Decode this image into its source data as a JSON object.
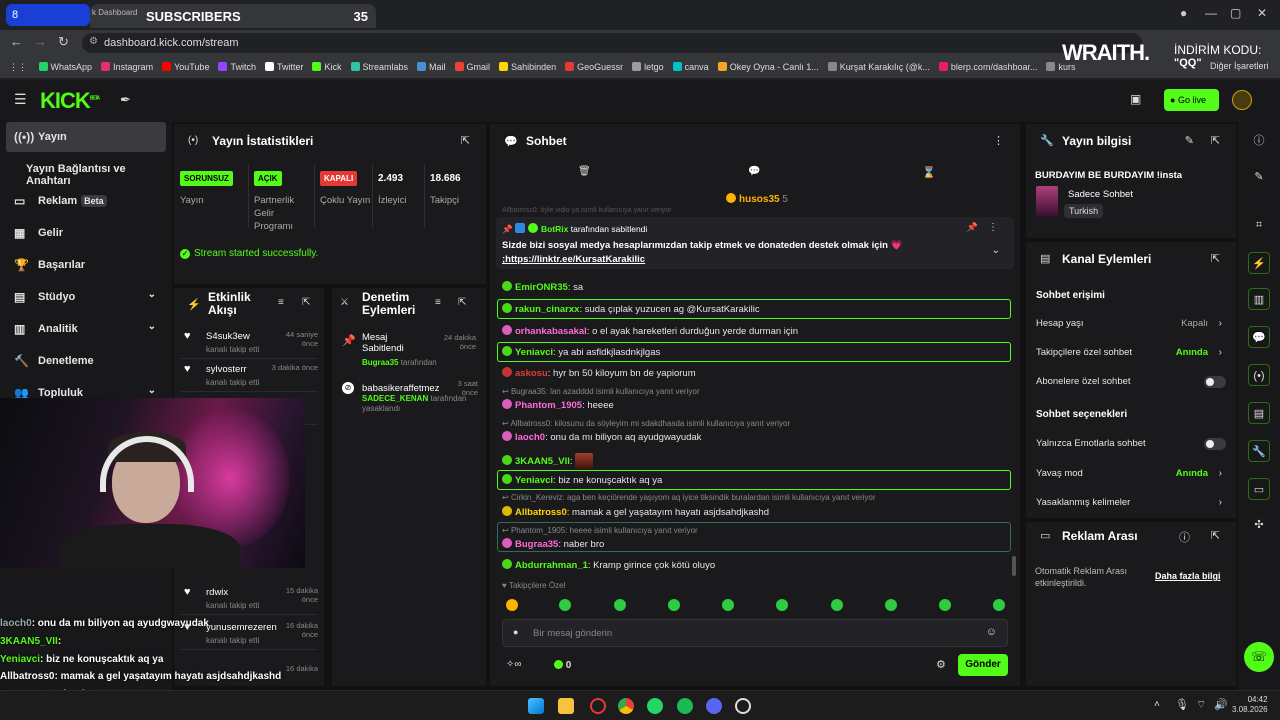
{
  "browser": {
    "tab_left_number": "8",
    "tab_label_small": "k Dashboard",
    "tab_title": "SUBSCRIBERS",
    "tab_count": "35",
    "url": "dashboard.kick.com/stream",
    "bookmarks": [
      "WhatsApp",
      "Instagram",
      "YouTube",
      "Twitch",
      "Twitter",
      "Kick",
      "Streamlabs",
      "Mail",
      "Gmail",
      "Sahibinden",
      "GeoGuessr",
      "letgo",
      "canva",
      "Okey Oyna - Canlı 1...",
      "Kurşat Karakılıç (@k...",
      "blerp.com/dashboar...",
      "kurs"
    ],
    "bookmark_colors": [
      "#25d366",
      "#e1306c",
      "#ff0000",
      "#9146ff",
      "#ffffff",
      "#53fc18",
      "#31c3a2",
      "#4a90d9",
      "#ea4335",
      "#ffd700",
      "#e53935",
      "#9e9e9e",
      "#00c4cc",
      "#f5a623",
      "#888888",
      "#e91e63",
      "#888888"
    ],
    "other_bookmarks": "Diğer İşaretleri",
    "promo_brand": "WRAITH.",
    "promo_text": "İNDİRİM KODU:",
    "promo_code": "\"QQ\""
  },
  "topnav": {
    "logo": "KICK",
    "logo_sup": "BETA",
    "go_live": "Go live"
  },
  "sidebar": {
    "items": [
      {
        "label": "Yayın",
        "icon": "broadcast-icon"
      },
      {
        "label": "Yayın Bağlantısı ve Anahtarı",
        "icon": ""
      },
      {
        "label": "Reklam",
        "icon": "ad-icon",
        "badge": "Beta"
      },
      {
        "label": "Gelir",
        "icon": "revenue-icon"
      },
      {
        "label": "Başarılar",
        "icon": "trophy-icon"
      },
      {
        "label": "Stüdyo",
        "icon": "studio-icon"
      },
      {
        "label": "Analitik",
        "icon": "analytics-icon"
      },
      {
        "label": "Denetleme",
        "icon": "moderation-icon"
      },
      {
        "label": "Topluluk",
        "icon": "community-icon"
      }
    ]
  },
  "stats": {
    "title": "Yayın İstatistikleri",
    "cols": [
      {
        "badge": "SORUNSUZ",
        "badge_color": "#53fc18",
        "label": "Yayın"
      },
      {
        "badge": "AÇIK",
        "badge_color": "#53fc18",
        "label": "Partnerlik Gelir Programı"
      },
      {
        "badge": "KAPALI",
        "badge_color": "#e53935",
        "label": "Çoklu Yayın"
      },
      {
        "badge": "2.493",
        "badge_color": "",
        "label": "İzleyici"
      },
      {
        "badge": "18.686",
        "badge_color": "",
        "label": "Takipçi"
      }
    ],
    "success": "Stream started successfully."
  },
  "activity": {
    "title": "Etkinlik Akışı",
    "items": [
      {
        "user": "S4suk3ew",
        "time": "44 saniye önce",
        "action": "kanalı takip etti"
      },
      {
        "user": "sylvosterr",
        "time": "3 dakika önce",
        "action": "kanalı takip etti"
      },
      {
        "user": "",
        "time": "",
        "action": "kanalı takip etti"
      },
      {
        "user": "rdwix",
        "time": "15 dakika önce",
        "action": "kanalı takip etti"
      },
      {
        "user": "yunusemrezeren",
        "time": "16 dakika önce",
        "action": "kanalı takip etti"
      },
      {
        "user": "",
        "time": "16 dakika",
        "action": ""
      }
    ]
  },
  "modlog": {
    "title": "Denetim Eylemleri",
    "items": [
      {
        "title": "Mesaj Sabitlendi",
        "time": "24 dakika önce",
        "by": "Bugraa35",
        "by_suffix": "tarafından"
      },
      {
        "title": "babasikeraffetmez",
        "time": "3 saat önce",
        "by": "SADECE_KENAN",
        "by_suffix": "tarafından yasaklandı"
      }
    ]
  },
  "chat": {
    "title": "Sohbet",
    "top_user": "husos35",
    "top_count": "5",
    "faded_reply": "Allbatross0: öyle vidio ya isimli kullanıcıya yanıt veriyor",
    "pinned_by": "BotRix",
    "pinned_suffix": "tarafından sabitlendi",
    "pinned_text": "Sizde bizi sosyal medya hesaplarımızdan takip etmek ve donateden destek olmak için 💗",
    "pinned_link": ";https://linktr.ee/KursatKarakilic",
    "messages": [
      {
        "user": "EmirONR35",
        "color": "#53fc18",
        "text": "sa",
        "reply": "",
        "hl": false
      },
      {
        "user": "rakun_cinarxx",
        "color": "#53fc18",
        "text": "suda çıplak yuzucen ag @KursatKarakilic",
        "reply": "",
        "hl": true
      },
      {
        "user": "orhankabasakal",
        "color": "#ff6bd6",
        "text": "o el ayak hareketleri durduğun yerde durman için",
        "reply": "",
        "hl": false
      },
      {
        "user": "Yeniavci",
        "color": "#53fc18",
        "text": "ya abi asfldkjlasdnkjlgas",
        "reply": "",
        "hl": true
      },
      {
        "user": "askosu",
        "color": "#e53935",
        "text": "hyr bn 50 kiloyum bn de yapiorum",
        "reply": "",
        "hl": false
      },
      {
        "user": "Phantom_1905",
        "color": "#ff6bd6",
        "text": "heeee",
        "reply": "Bugraa35: lan azadddd isimli kullanıcıya yanıt veriyor",
        "hl": false
      },
      {
        "user": "laoch0",
        "color": "#ff6bd6",
        "text": "onu da mı biliyon aq ayudgwayudak",
        "reply": "Allbatross0: kilosunu da söyleyim mi sdakdhasda isimli kullanıcıya yanıt veriyor",
        "hl": false
      },
      {
        "user": "3KAAN5_Vll",
        "color": "#53fc18",
        "text": "",
        "reply": "",
        "hl": false
      },
      {
        "user": "Yeniavci",
        "color": "#53fc18",
        "text": "biz ne konuşcaktık aq ya",
        "reply": "",
        "hl": true
      },
      {
        "user": "Allbatross0",
        "color": "#ffd700",
        "text": "mamak a gel yaşatayım hayatı asjdsahdjkashd",
        "reply": "Cirkin_Kereviz: aga ben keçiörende yaşıyom aq iyice tiksindik buralardan isimli kullanıcıya yanıt veriyor",
        "hl": false
      },
      {
        "user": "Bugraa35",
        "color": "#ff6bd6",
        "text": "naber bro",
        "reply": "Phantom_1905: heeee isimli kullanıcıya yanıt veriyor",
        "hl": false
      },
      {
        "user": "Abdurrahman_1",
        "color": "#53fc18",
        "text": "Kramp girince çok kötü oluyo",
        "reply": "",
        "hl": false
      }
    ],
    "follower_only": "Takipçilere Özel",
    "input_placeholder": "Bir mesaj gönderin",
    "points": "0",
    "send": "Gönder"
  },
  "stream_info": {
    "title": "Yayın bilgisi",
    "stream_title": "BURDAYIM BE BURDAYIM !insta",
    "category": "Sadece Sohbet",
    "language": "Turkish"
  },
  "channel_actions": {
    "title": "Kanal Eylemleri",
    "access_heading": "Sohbet erişimi",
    "rows": [
      {
        "label": "Hesap yaşı",
        "value": "Kapalı",
        "type": "arrow"
      },
      {
        "label": "Takipçilere özel sohbet",
        "value": "Anında",
        "type": "arrow"
      },
      {
        "label": "Abonelere özel sohbet",
        "value": "",
        "type": "toggle"
      }
    ],
    "options_heading": "Sohbet seçenekleri",
    "option_rows": [
      {
        "label": "Yalnızca Emotlarla sohbet",
        "value": "",
        "type": "toggle"
      },
      {
        "label": "Yavaş mod",
        "value": "Anında",
        "type": "arrow"
      },
      {
        "label": "Yasaklanmış kelimeler",
        "value": "",
        "type": "arrow"
      }
    ]
  },
  "ad_break": {
    "title": "Reklam Arası",
    "text": "Otomatik Reklam Arası etkinleştirildi.",
    "link": "Daha fazla bilgi"
  },
  "overlay_chat": [
    {
      "user": "laoch0",
      "text": "onu da mı biliyon aq ayudgwayudak",
      "color": "#9aa"
    },
    {
      "user": "3KAAN5_VII",
      "text": "",
      "color": "#53fc18"
    },
    {
      "user": "Yeniavci",
      "text": "biz ne konuşcaktık aq ya",
      "color": "#53fc18"
    },
    {
      "user": "Allbatross0",
      "text": "mamak a gel yaşatayım hayatı asjdsahdjkashd",
      "color": "#fff"
    },
    {
      "user": "Bugraa35",
      "text": "naber bro",
      "color": "#ff6bd6"
    },
    {
      "user": "Abdurrahman_1",
      "text": "Kramp girince çok kötü oluyo",
      "color": "#fff"
    }
  ],
  "taskbar": {
    "time": "04:42",
    "date": "3.08.2026"
  }
}
